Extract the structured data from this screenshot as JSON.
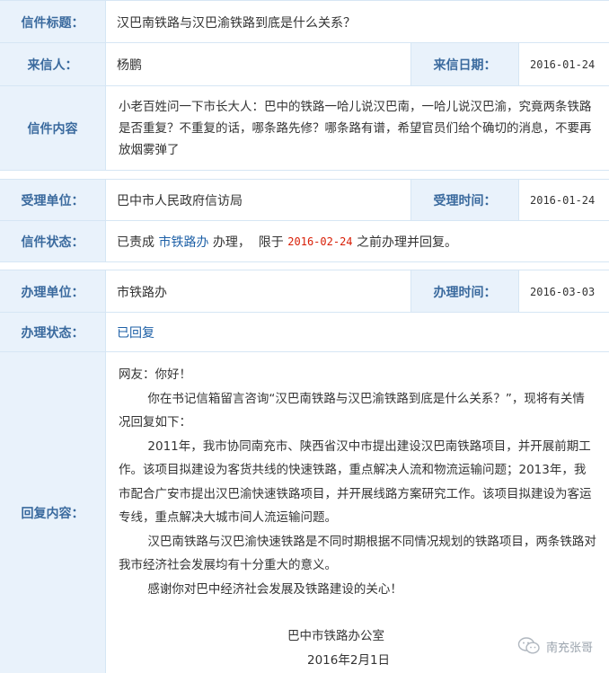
{
  "letter": {
    "title_label": "信件标题：",
    "title_value": "汉巴南铁路与汉巴渝铁路到底是什么关系？",
    "sender_label": "来信人：",
    "sender_value": "杨鹏",
    "date_label": "来信日期：",
    "date_value": "2016-01-24",
    "content_label": "信件内容",
    "content_value": "小老百姓问一下市长大人：巴中的铁路一哈儿说汉巴南，一哈儿说汉巴渝，究竟两条铁路是否重复？不重复的话，哪条路先修？哪条路有谱，希望官员们给个确切的消息，不要再放烟雾弹了"
  },
  "accept": {
    "unit_label": "受理单位：",
    "unit_value": "巴中市人民政府信访局",
    "time_label": "受理时间：",
    "time_value": "2016-01-24",
    "status_label": "信件状态：",
    "status_pre": "已责成",
    "status_dept": "市铁路办",
    "status_mid": "办理，  限于",
    "status_deadline": "2016-02-24",
    "status_post": "之前办理并回复。"
  },
  "handle": {
    "unit_label": "办理单位：",
    "unit_value": "市铁路办",
    "time_label": "办理时间：",
    "time_value": "2016-03-03",
    "status_label": "办理状态：",
    "status_value": "已回复",
    "reply_label": "回复内容：",
    "reply": {
      "greeting": "网友：你好！",
      "p1": "你在书记信箱留言咨询“汉巴南铁路与汉巴渝铁路到底是什么关系？”，现将有关情况回复如下：",
      "p2": "2011年，我市协同南充市、陕西省汉中市提出建设汉巴南铁路项目，并开展前期工作。该项目拟建设为客货共线的快速铁路，重点解决人流和物流运输问题；2013年，我市配合广安市提出汉巴渝快速铁路项目，并开展线路方案研究工作。该项目拟建设为客运专线，重点解决大城市间人流运输问题。",
      "p3": "汉巴南铁路与汉巴渝快速铁路是不同时期根据不同情况规划的铁路项目，两条铁路对我市经济社会发展均有十分重大的意义。",
      "p4": "感谢你对巴中经济社会发展及铁路建设的关心！",
      "sign_org": "巴中市铁路办公室",
      "sign_date": "2016年2月1日"
    }
  },
  "watermark": {
    "text": "南充张哥",
    "icon": "wechat-icon"
  }
}
